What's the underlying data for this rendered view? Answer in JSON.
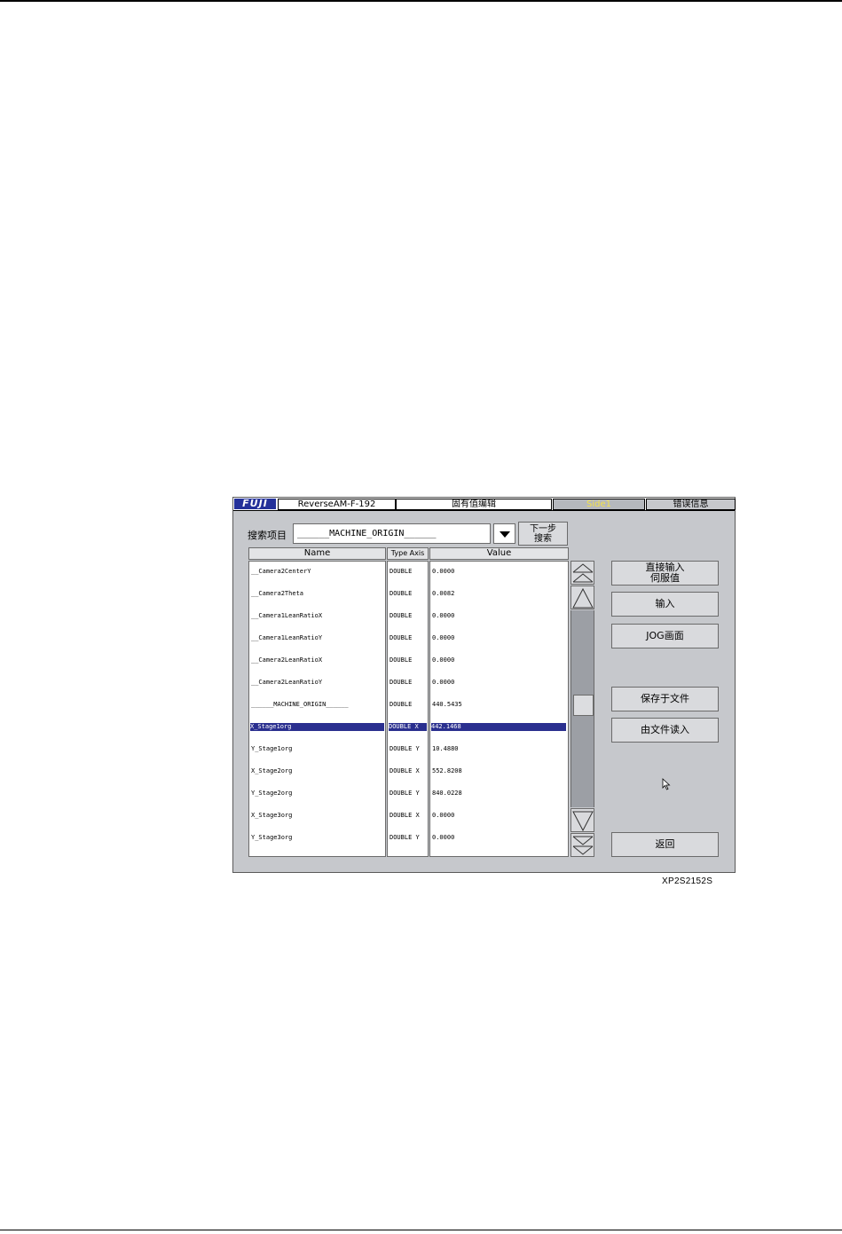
{
  "titlebar": {
    "logo": "FUJI",
    "program": "ReverseAM-F-192",
    "screen_name": "固有值编辑",
    "side": "Side1",
    "error_info": "错误信息"
  },
  "search": {
    "label": "搜索项目",
    "value": "______MACHINE_ORIGIN______",
    "next_line1": "下一步",
    "next_line2": "搜索"
  },
  "table": {
    "headers": {
      "name": "Name",
      "type": "Type Axis",
      "value": "Value"
    },
    "rows": [
      {
        "name": "__Camera2CenterY",
        "type": "DOUBLE",
        "value": "0.0000"
      },
      {
        "name": "__Camera2Theta",
        "type": "DOUBLE",
        "value": "0.0082"
      },
      {
        "name": "__Camera1LeanRatioX",
        "type": "DOUBLE",
        "value": "0.0000"
      },
      {
        "name": "__Camera1LeanRatioY",
        "type": "DOUBLE",
        "value": "0.0000"
      },
      {
        "name": "__Camera2LeanRatioX",
        "type": "DOUBLE",
        "value": "0.0000"
      },
      {
        "name": "__Camera2LeanRatioY",
        "type": "DOUBLE",
        "value": "0.0000"
      },
      {
        "name": "______MACHINE_ORIGIN______",
        "type": "DOUBLE",
        "value": "440.5435"
      },
      {
        "name": "X_Stage1org",
        "type": "DOUBLE X",
        "value": "442.1468"
      },
      {
        "name": "Y_Stage1org",
        "type": "DOUBLE Y",
        "value": "10.4880"
      },
      {
        "name": "X_Stage2org",
        "type": "DOUBLE X",
        "value": "552.8208"
      },
      {
        "name": "Y_Stage2org",
        "type": "DOUBLE Y",
        "value": "840.0228"
      },
      {
        "name": "X_Stage3org",
        "type": "DOUBLE X",
        "value": "0.0000"
      },
      {
        "name": "Y_Stage3org",
        "type": "DOUBLE Y",
        "value": "0.0000"
      }
    ],
    "selected_index": 7
  },
  "scroll": {
    "position_fraction": 0.48
  },
  "buttons": {
    "direct_line1": "直接输入",
    "direct_line2": "伺服值",
    "input": "输入",
    "jog": "JOG画面",
    "save": "保存于文件",
    "load": "由文件读入",
    "back": "返回"
  },
  "caption": "XP2S2152S",
  "colors": {
    "screen_bg": "#c6c8cc",
    "logo_bg": "#24319a",
    "selection": "#2a2f8f",
    "side_text": "#f4e24a",
    "scroll_track": "#9c9fa5"
  }
}
